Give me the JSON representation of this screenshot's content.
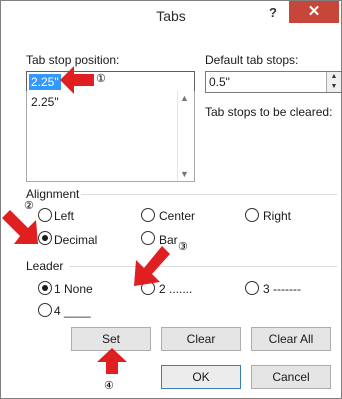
{
  "window": {
    "title": "Tabs",
    "help_label": "?",
    "close_label": "✕"
  },
  "tab_stop": {
    "label": "Tab stop position:",
    "value": "2.25\"",
    "list_items": [
      "2.25\""
    ]
  },
  "default_tab_stops": {
    "label": "Default tab stops:",
    "value": "0.5\""
  },
  "cleared_label": "Tab stops to be cleared:",
  "alignment": {
    "heading": "Alignment",
    "options": {
      "left": "Left",
      "center": "Center",
      "right": "Right",
      "decimal": "Decimal",
      "bar": "Bar"
    },
    "selected": "Decimal"
  },
  "leader": {
    "heading": "Leader",
    "options": {
      "o1": "1 None",
      "o2": "2 .......",
      "o3": "3 -------",
      "o4": "4 ____"
    },
    "selected": "1 None"
  },
  "buttons": {
    "set": "Set",
    "clear": "Clear",
    "clear_all": "Clear All",
    "ok": "OK",
    "cancel": "Cancel"
  },
  "callouts": {
    "c1": "①",
    "c2": "②",
    "c3": "③",
    "c4": "④"
  },
  "colors": {
    "accent": "#e02020",
    "selection": "#3399ff",
    "close": "#c7463a"
  }
}
